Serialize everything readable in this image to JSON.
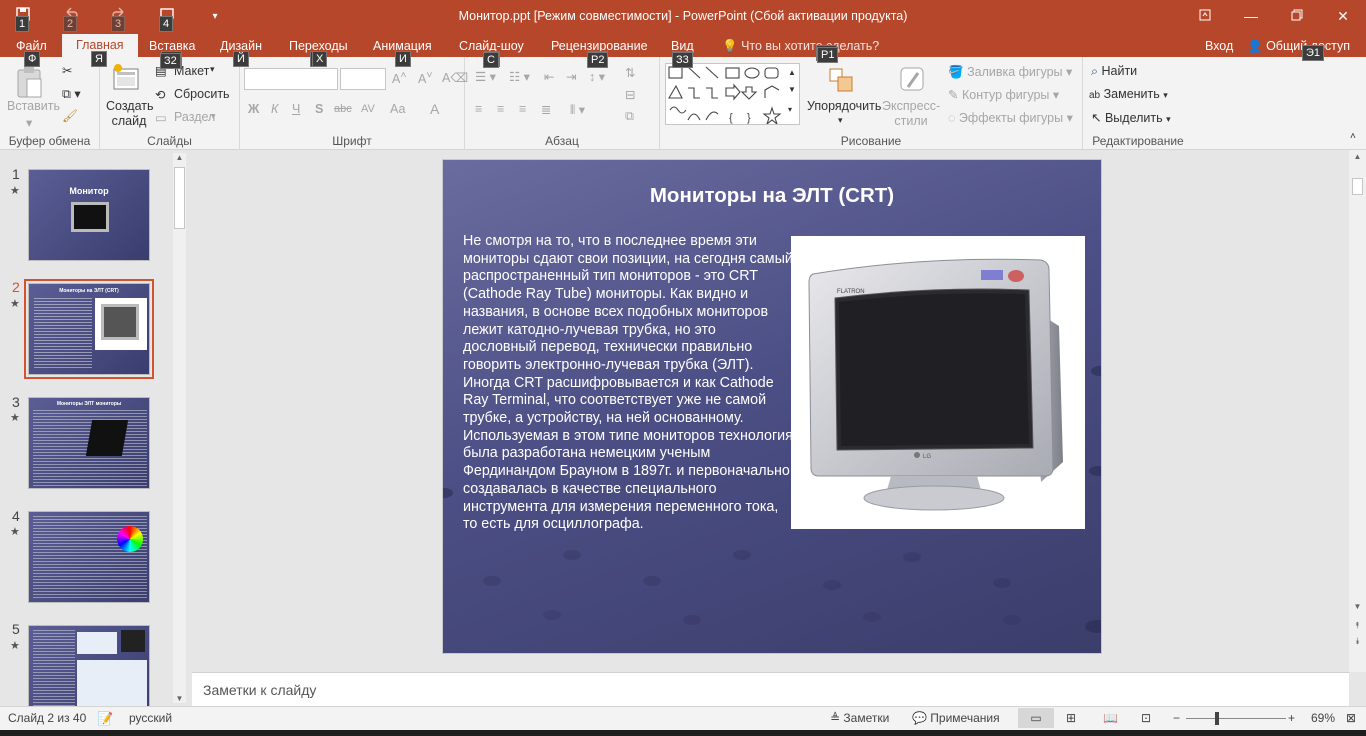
{
  "window": {
    "title": "Монитор.ppt [Режим совместимости] - PowerPoint (Сбой активации продукта)",
    "buttons": [
      "restore-ribbon",
      "minimize",
      "maximize",
      "close"
    ]
  },
  "qat_keytips": [
    "1",
    "2",
    "3",
    "4"
  ],
  "tabs": {
    "file": "Файл",
    "home": "Главная",
    "insert": "Вставка",
    "design": "Дизайн",
    "transitions": "Переходы",
    "animation": "Анимация",
    "slideshow": "Слайд-шоу",
    "review": "Рецензирование",
    "view": "Вид",
    "tellme": "Что вы хотите сделать?",
    "signin": "Вход",
    "share": "Общий доступ"
  },
  "keytips": {
    "file": "Ф",
    "home": "Я",
    "insert": "З2",
    "design": "Й",
    "transitions": "Х",
    "animation": "И",
    "slideshow": "С",
    "review": "Р2",
    "view": "З3",
    "tellme": "Р1",
    "share": "Э1"
  },
  "ribbon": {
    "clipboard": {
      "label": "Буфер обмена",
      "paste": "Вставить"
    },
    "slides": {
      "label": "Слайды",
      "new_slide": "Создать слайд",
      "layout": "Макет",
      "reset": "Сбросить",
      "section": "Раздел"
    },
    "font": {
      "label": "Шрифт",
      "bold": "Ж",
      "italic": "К",
      "underline": "Ч",
      "shadow": "S",
      "strike": "abc",
      "spacing": "AV",
      "case": "Аа",
      "color": "А"
    },
    "paragraph": {
      "label": "Абзац"
    },
    "drawing": {
      "label": "Рисование",
      "arrange": "Упорядочить",
      "quick_styles": "Экспресс-стили",
      "fill": "Заливка фигуры",
      "outline": "Контур фигуры",
      "effects": "Эффекты фигуры"
    },
    "editing": {
      "label": "Редактирование",
      "find": "Найти",
      "replace": "Заменить",
      "select": "Выделить"
    }
  },
  "thumbnails": [
    {
      "num": "1",
      "star": "★",
      "title": "Монитор"
    },
    {
      "num": "2",
      "star": "★",
      "title": "Мониторы на ЭЛТ (CRT)"
    },
    {
      "num": "3",
      "star": "★",
      "title": "Мониторы ЭЛТ мониторы"
    },
    {
      "num": "4",
      "star": "★",
      "title": ""
    },
    {
      "num": "5",
      "star": "★",
      "title": ""
    }
  ],
  "slide": {
    "title": "Мониторы на ЭЛТ (CRT)",
    "body": "Не смотря на то, что в последнее время эти мониторы сдают свои позиции, на сегодня самый распространенный тип мониторов - это CRT (Cathode Ray Tube) мониторы. Как видно и названия, в основе всех подобных мониторов лежит катодно-лучевая трубка, но это дословный перевод, технически правильно говорить электронно-лучевая трубка (ЭЛТ). Иногда CRT расшифровывается и как Cathode Ray Terminal, что соответствует уже не самой трубке, а устройству, на ней основанному. Используемая в этом типе мониторов технология была разработана немецким ученым Фердинандом Брауном в 1897г. и первоначально создавалась в качестве специального инструмента для измерения переменного тока, то есть для осциллографа.",
    "image_alt": "CRT monitor",
    "monitor_brand": "FLATRON",
    "monitor_logo": "LG"
  },
  "notes_placeholder": "Заметки к слайду",
  "status": {
    "slide_info": "Слайд 2 из 40",
    "language": "русский",
    "notes": "Заметки",
    "comments": "Примечания",
    "zoom": "69%"
  },
  "colors": {
    "accent": "#b7472a",
    "slide_bg": "#4c4f85"
  }
}
